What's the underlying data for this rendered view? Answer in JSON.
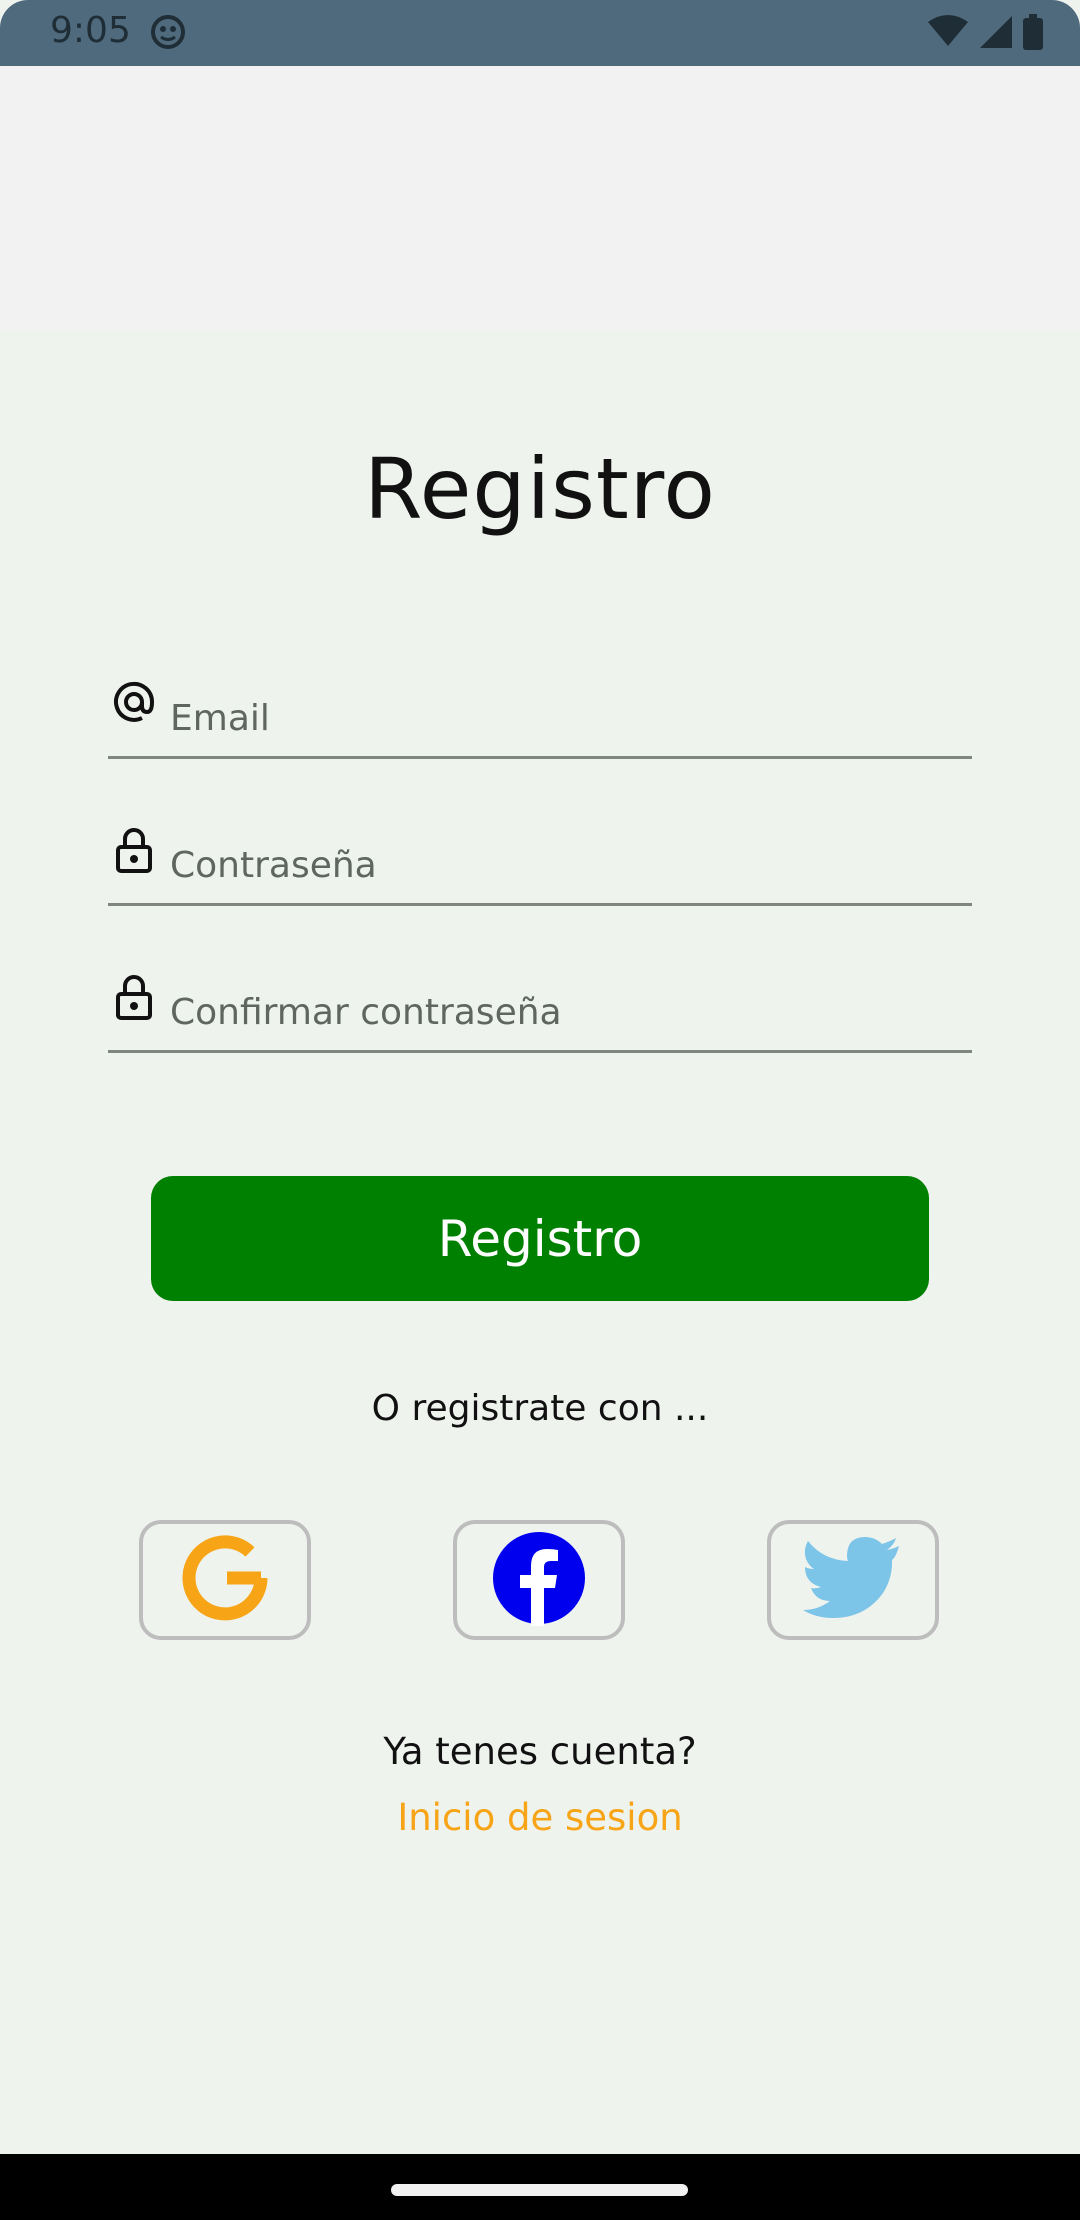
{
  "status_bar": {
    "time": "9:05",
    "icons": [
      "app-notification-icon",
      "wifi-icon",
      "signal-icon",
      "battery-icon"
    ]
  },
  "title": "Registro",
  "fields": [
    {
      "name": "email",
      "placeholder": "Email",
      "value": "",
      "icon": "at-icon"
    },
    {
      "name": "password",
      "placeholder": "Contraseña",
      "value": "",
      "icon": "lock-icon"
    },
    {
      "name": "confirm_password",
      "placeholder": "Confirmar contraseña",
      "value": "",
      "icon": "lock-icon"
    }
  ],
  "register_button": "Registro",
  "alt_text": "O registrate con ...",
  "social": [
    {
      "name": "google",
      "icon": "google-icon",
      "color": "#f7a416"
    },
    {
      "name": "facebook",
      "icon": "facebook-icon",
      "color": "#0000ee"
    },
    {
      "name": "twitter",
      "icon": "twitter-icon",
      "color": "#7cc4e8"
    }
  ],
  "account_question": "Ya tenes cuenta?",
  "login_link": "Inicio de sesion",
  "colors": {
    "primary": "#008000",
    "link": "#f7a416",
    "background": "#eff3ee",
    "status_bar": "#4f6a7c"
  }
}
